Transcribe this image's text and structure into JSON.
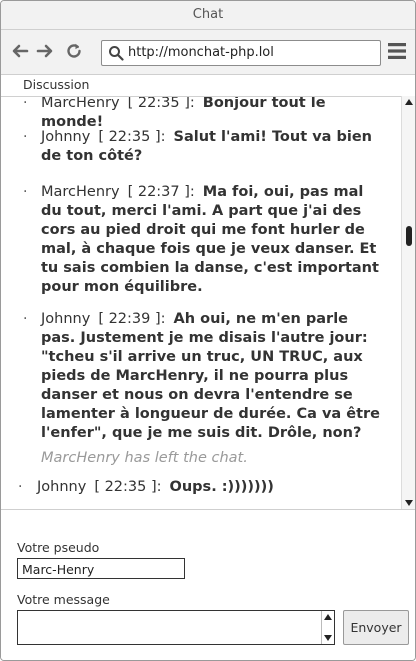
{
  "window": {
    "title": "Chat"
  },
  "toolbar": {
    "url": "http://monchat-php.lol",
    "icons": [
      "back-arrow-icon",
      "forward-arrow-icon",
      "reload-icon",
      "search-icon",
      "menu-icon"
    ]
  },
  "tab": {
    "label": "Discussion"
  },
  "chat": {
    "messages": [
      {
        "bullet": "·",
        "author": "MarcHenry",
        "time": "[ 22:35 ]:",
        "text": "Bonjour tout le monde!"
      },
      {
        "bullet": "·",
        "author": "Johnny",
        "time": "[ 22:35 ]:",
        "text": "Salut l'ami! Tout va bien de ton côté?"
      },
      {
        "bullet": "·",
        "author": "MarcHenry",
        "time": "[ 22:37 ]:",
        "text": "Ma foi, oui, pas mal du tout, merci l'ami. A part que j'ai des cors au pied droit qui me font hurler de mal, à chaque fois que je veux danser. Et tu sais combien la danse, c'est important pour mon équilibre."
      },
      {
        "bullet": "·",
        "author": "Johnny",
        "time": "[ 22:39 ]:",
        "text": "Ah oui, ne m'en parle pas. Justement je me disais l'autre jour: \"tcheu s'il arrive un truc, UN TRUC, aux pieds de MarcHenry, il ne pourra plus danser et nous on devra l'entendre se lamenter à longueur de durée. Ca va être l'enfer\", que je me suis dit. Drôle, non?"
      },
      {
        "bullet": "·",
        "author": "Johnny",
        "time": "[ 22:35 ]:",
        "text": "Oups.  :)))))))"
      }
    ],
    "system_message": "MarcHenry has left the chat."
  },
  "form": {
    "pseudo_label": "Votre pseudo",
    "pseudo_value": "Marc-Henry",
    "message_label": "Votre message",
    "message_value": "",
    "send_label": "Envoyer"
  }
}
